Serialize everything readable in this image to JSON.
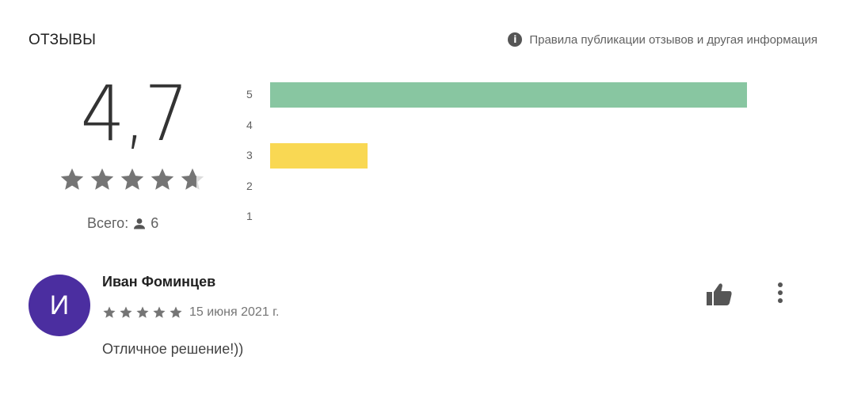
{
  "reviews_section": {
    "title": "ОТЗЫВЫ",
    "info_link": {
      "icon": "info-icon",
      "icon_glyph": "i",
      "label": "Правила публикации отзывов и другая информация"
    }
  },
  "rating_summary": {
    "score": "4,7",
    "stars": 4.7,
    "star_color": "#757575",
    "total_label": "Всего:",
    "total_icon": "person-icon",
    "total_count": "6"
  },
  "histogram": {
    "rows": [
      {
        "label": "5",
        "fraction": 0.83,
        "color": "#88c6a1"
      },
      {
        "label": "4",
        "fraction": 0,
        "color": "#88c6a1"
      },
      {
        "label": "3",
        "fraction": 0.17,
        "color": "#f9d853"
      },
      {
        "label": "2",
        "fraction": 0,
        "color": "#f9d853"
      },
      {
        "label": "1",
        "fraction": 0,
        "color": "#f9d853"
      }
    ]
  },
  "review": {
    "avatar_letter": "И",
    "avatar_color": "#4b2ea0",
    "author": "Иван Фоминцев",
    "stars": 5,
    "date": "15 июня 2021 г.",
    "text": "Отличное решение!))",
    "like_icon": "thumbs-up-icon",
    "menu_icon": "more-vert-icon"
  }
}
